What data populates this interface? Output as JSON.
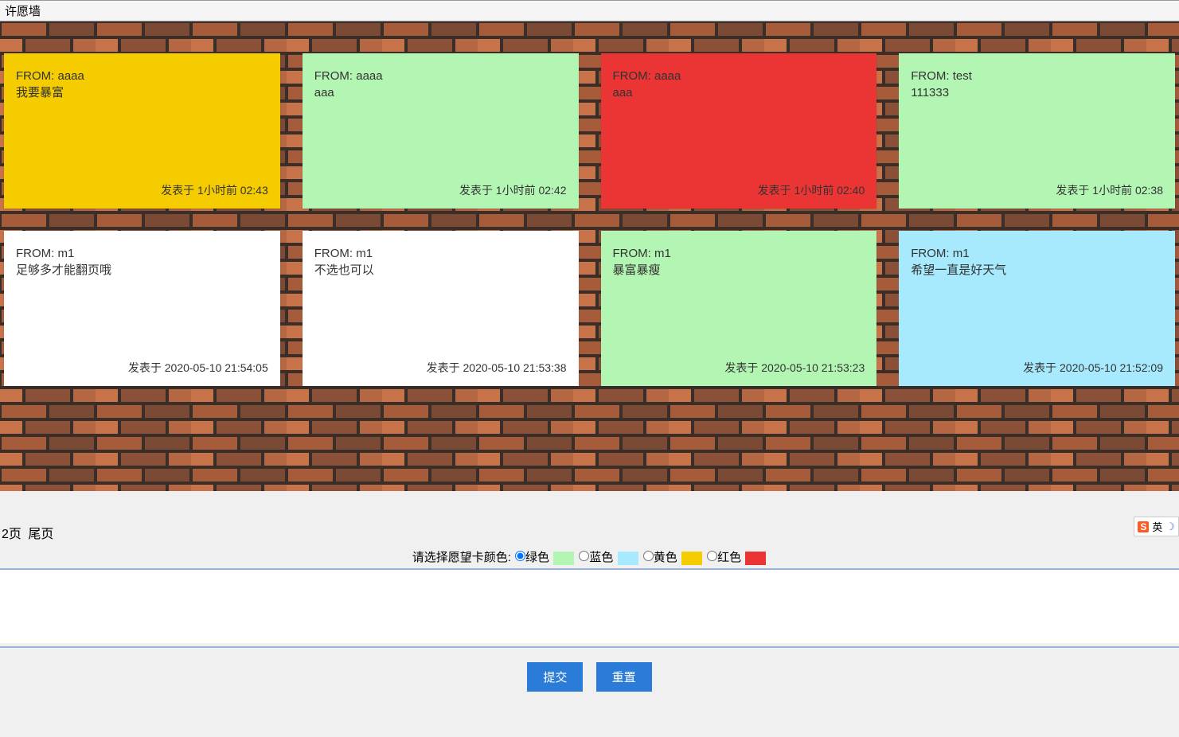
{
  "title": "许愿墙",
  "from_prefix": "FROM: ",
  "time_prefix": "发表于 ",
  "cards": [
    {
      "from": "aaaa",
      "msg": "我要暴富",
      "time": "1小时前 02:43",
      "color": "#f5cc00"
    },
    {
      "from": "aaaa",
      "msg": "aaa",
      "time": "1小时前 02:42",
      "color": "#b3f5b3"
    },
    {
      "from": "aaaa",
      "msg": "aaa",
      "time": "1小时前 02:40",
      "color": "#eb3434"
    },
    {
      "from": "test",
      "msg": "111333",
      "time": "1小时前 02:38",
      "color": "#b3f5b3"
    },
    {
      "from": "m1",
      "msg": "足够多才能翻页哦",
      "time": "2020-05-10 21:54:05",
      "color": "#ffffff"
    },
    {
      "from": "m1",
      "msg": "不选也可以",
      "time": "2020-05-10 21:53:38",
      "color": "#ffffff"
    },
    {
      "from": "m1",
      "msg": "暴富暴瘦",
      "time": "2020-05-10 21:53:23",
      "color": "#b3f5b3"
    },
    {
      "from": "m1",
      "msg": "希望一直是好天气",
      "time": "2020-05-10 21:52:09",
      "color": "#a7e9fd"
    }
  ],
  "pager": {
    "page_label": "2页",
    "last_label": "尾页"
  },
  "ime": {
    "s": "S",
    "lang": "英",
    "moon": "☽"
  },
  "color_form": {
    "label": "请选择愿望卡颜色:",
    "options": {
      "green": "绿色",
      "blue": "蓝色",
      "yellow": "黄色",
      "red": "红色"
    }
  },
  "buttons": {
    "submit": "提交",
    "reset": "重置"
  },
  "textarea_value": ""
}
